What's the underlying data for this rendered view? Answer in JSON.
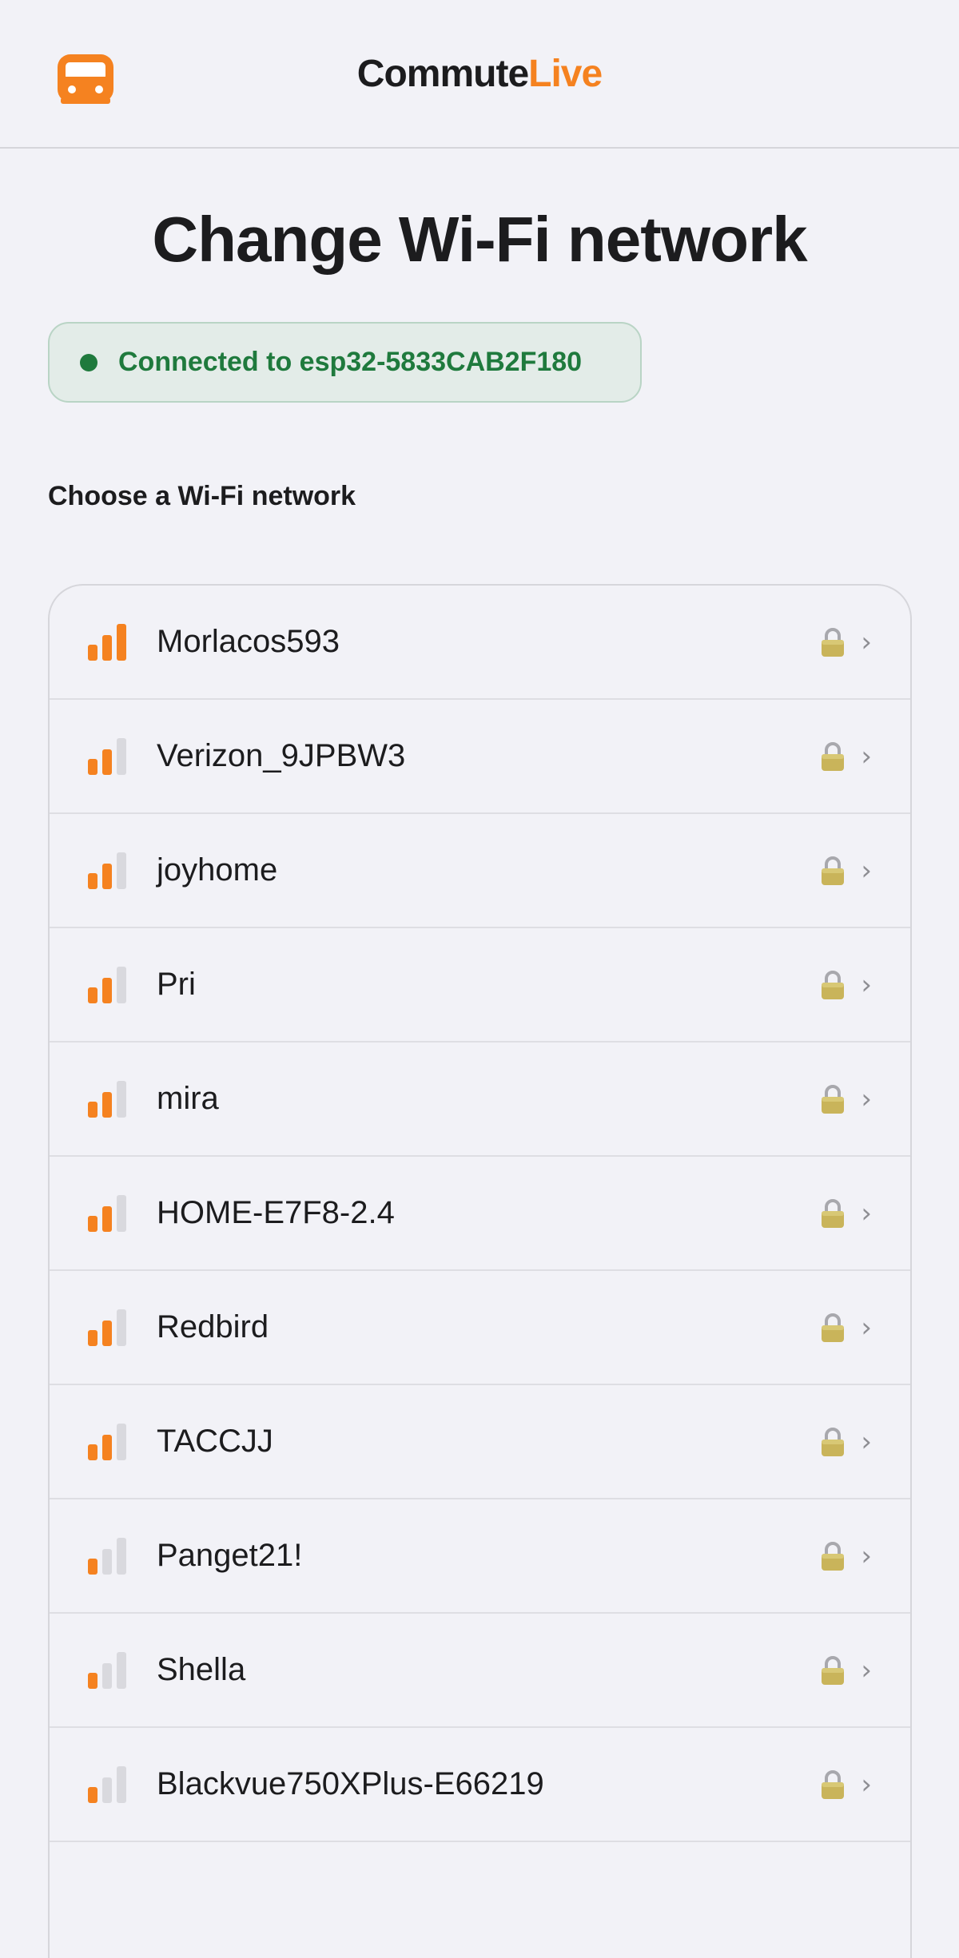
{
  "header": {
    "brand_part1": "Commute",
    "brand_part2": "Live",
    "icon": "bus-icon",
    "accent_color": "#f58220"
  },
  "page": {
    "title": "Change Wi-Fi network"
  },
  "status": {
    "text": "Connected to esp32-5833CAB2F180",
    "color": "#1f7a3d"
  },
  "section": {
    "label": "Choose a Wi-Fi network"
  },
  "networks": [
    {
      "name": "Morlacos593",
      "signal_bars": 3,
      "secured": true
    },
    {
      "name": "Verizon_9JPBW3",
      "signal_bars": 2,
      "secured": true
    },
    {
      "name": "joyhome",
      "signal_bars": 2,
      "secured": true
    },
    {
      "name": "Pri",
      "signal_bars": 2,
      "secured": true
    },
    {
      "name": "mira",
      "signal_bars": 2,
      "secured": true
    },
    {
      "name": "HOME-E7F8-2.4",
      "signal_bars": 2,
      "secured": true
    },
    {
      "name": "Redbird",
      "signal_bars": 2,
      "secured": true
    },
    {
      "name": "TACCJJ",
      "signal_bars": 2,
      "secured": true
    },
    {
      "name": "Panget21!",
      "signal_bars": 1,
      "secured": true
    },
    {
      "name": "Shella",
      "signal_bars": 1,
      "secured": true
    },
    {
      "name": "Blackvue750XPlus-E66219",
      "signal_bars": 1,
      "secured": true
    }
  ],
  "icons": {
    "signal": "wifi-signal-icon",
    "lock": "lock-icon",
    "chevron": "chevron-right-icon"
  },
  "colors": {
    "signal_active": "#f58220",
    "signal_inactive": "#d9d9de",
    "status_bg": "#e3ece8"
  }
}
